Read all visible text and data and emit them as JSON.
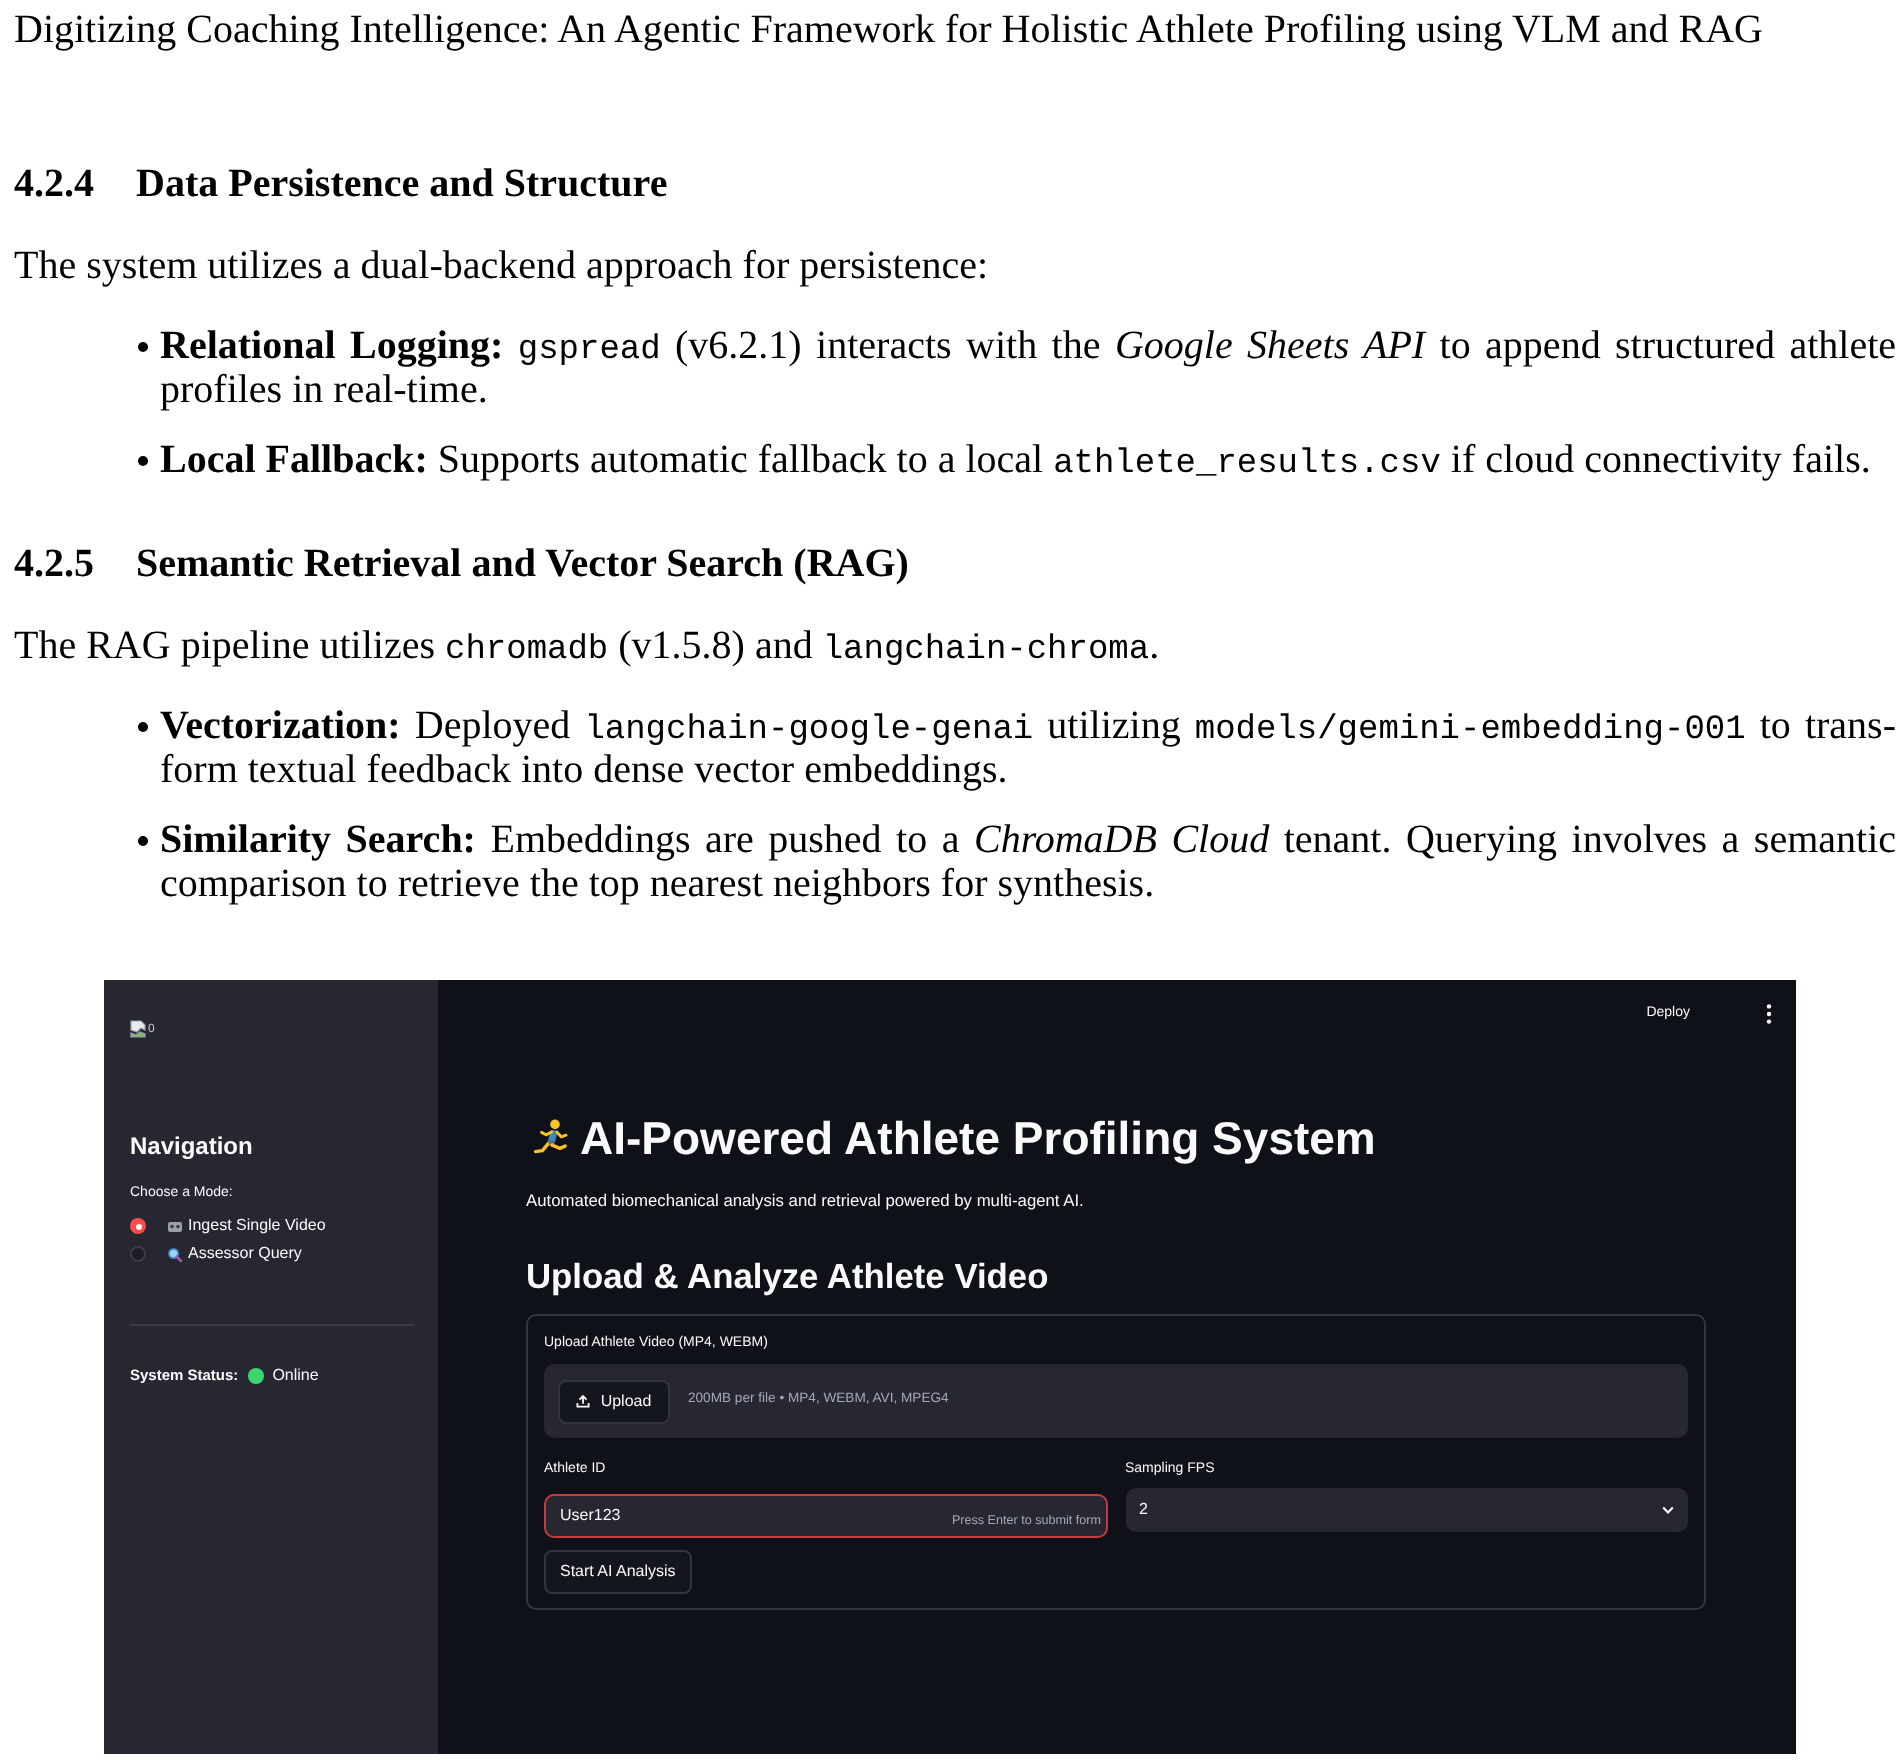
{
  "page_header": "Digitizing Coaching Intelligence: An Agentic Framework for Holistic Athlete Profiling using VLM and RAG",
  "sections": [
    {
      "number": "4.2.4",
      "title": "Data Persistence and Structure",
      "intro": [
        {
          "kind": "text",
          "text": "The system utilizes a dual-backend approach for persistence:"
        }
      ],
      "bullets": [
        [
          {
            "kind": "text",
            "text": "**Relational Logging:** "
          },
          {
            "kind": "code",
            "text": "gspread"
          },
          {
            "kind": "text",
            "text": " (v6.2.1) interacts with the *Google Sheets API* to append structured athlete profiles in real-time."
          }
        ],
        [
          {
            "kind": "text",
            "text": "**Local Fallback:** Supports automatic fallback to a local "
          },
          {
            "kind": "code",
            "text": "athlete_results.csv"
          },
          {
            "kind": "text",
            "text": " if cloud connectivity fails."
          }
        ]
      ]
    },
    {
      "number": "4.2.5",
      "title": "Semantic Retrieval and Vector Search (RAG)",
      "intro": [
        {
          "kind": "text",
          "text": "The RAG pipeline utilizes "
        },
        {
          "kind": "code",
          "text": "chromadb"
        },
        {
          "kind": "text",
          "text": " (v1.5.8) and "
        },
        {
          "kind": "code",
          "text": "langchain-chroma"
        },
        {
          "kind": "text",
          "text": "."
        }
      ],
      "bullets": [
        [
          {
            "kind": "text",
            "text": "**Vectorization:** Deployed "
          },
          {
            "kind": "code",
            "text": "langchain-google-genai"
          },
          {
            "kind": "text",
            "text": " utilizing "
          },
          {
            "kind": "code",
            "text": "models/gemini-embedding-001"
          },
          {
            "kind": "text",
            "text": " to trans-form textual feedback into dense vector embeddings."
          }
        ],
        [
          {
            "kind": "text",
            "text": "**Similarity Search:** Embeddings are pushed to a *ChromaDB Cloud* tenant. Querying involves a semantic comparison to retrieve the top nearest neighbors for synthesis."
          }
        ]
      ]
    }
  ],
  "figure": {
    "sidebar": {
      "logo_alt": "0",
      "heading": "Navigation",
      "mode_label": "Choose a Mode:",
      "modes": [
        {
          "label": "Ingest Single Video",
          "selected": true
        },
        {
          "label": "Assessor Query",
          "selected": false
        }
      ],
      "status_label": "System Status:",
      "status": {
        "text": "Online",
        "color": "#3dd56d"
      }
    },
    "toolbar": {
      "deploy": "Deploy"
    },
    "main": {
      "title": "AI-Powered Athlete Profiling System",
      "subtitle": "Automated biomechanical analysis and retrieval powered by multi-agent AI.",
      "section_title": "Upload & Analyze Athlete Video",
      "form": {
        "upload_label": "Upload Athlete Video (MP4, WEBM)",
        "upload_button": "Upload",
        "upload_hint": "200MB per file • MP4, WEBM, AVI, MPEG4",
        "athlete_id": {
          "label": "Athlete ID",
          "value": "User123",
          "hint": "Press Enter to submit form",
          "focused": true
        },
        "sampling_fps": {
          "label": "Sampling FPS",
          "value": "2"
        },
        "submit_button": "Start AI Analysis"
      }
    }
  }
}
